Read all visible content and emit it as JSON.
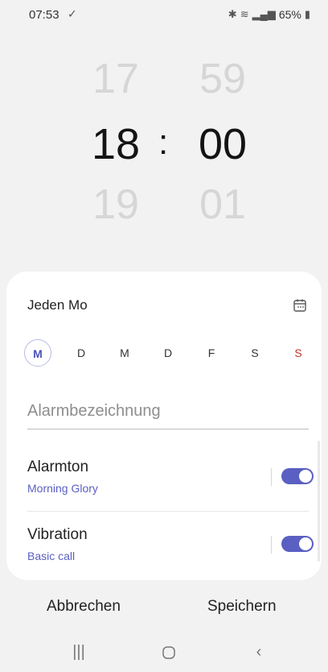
{
  "status_bar": {
    "time": "07:53",
    "left_icon": "check-icon",
    "battery": "65%",
    "icons": [
      "bluetooth-icon",
      "wifi-icon",
      "signal-icon",
      "battery-icon"
    ]
  },
  "picker": {
    "hours": {
      "prev": "17",
      "current": "18",
      "next": "19"
    },
    "minutes": {
      "prev": "59",
      "current": "00",
      "next": "01"
    },
    "separator": ":"
  },
  "card": {
    "repeat_label": "Jeden Mo",
    "days": [
      {
        "label": "M",
        "selected": true
      },
      {
        "label": "D",
        "selected": false
      },
      {
        "label": "M",
        "selected": false
      },
      {
        "label": "D",
        "selected": false
      },
      {
        "label": "F",
        "selected": false
      },
      {
        "label": "S",
        "selected": false
      },
      {
        "label": "S",
        "selected": false
      }
    ],
    "alarm_name_placeholder": "Alarmbezeichnung",
    "settings": [
      {
        "title": "Alarmton",
        "subtitle": "Morning Glory",
        "enabled": true
      },
      {
        "title": "Vibration",
        "subtitle": "Basic call",
        "enabled": true
      }
    ]
  },
  "actions": {
    "cancel_label": "Abbrechen",
    "save_label": "Speichern"
  },
  "navbar": {
    "recent_icon": "recent-apps-icon",
    "home_icon": "home-icon",
    "back_icon": "back-icon"
  },
  "colors": {
    "accent": "#5a5fc2",
    "sunday": "#c0392b",
    "background": "#f2f2f2",
    "card": "#ffffff"
  }
}
